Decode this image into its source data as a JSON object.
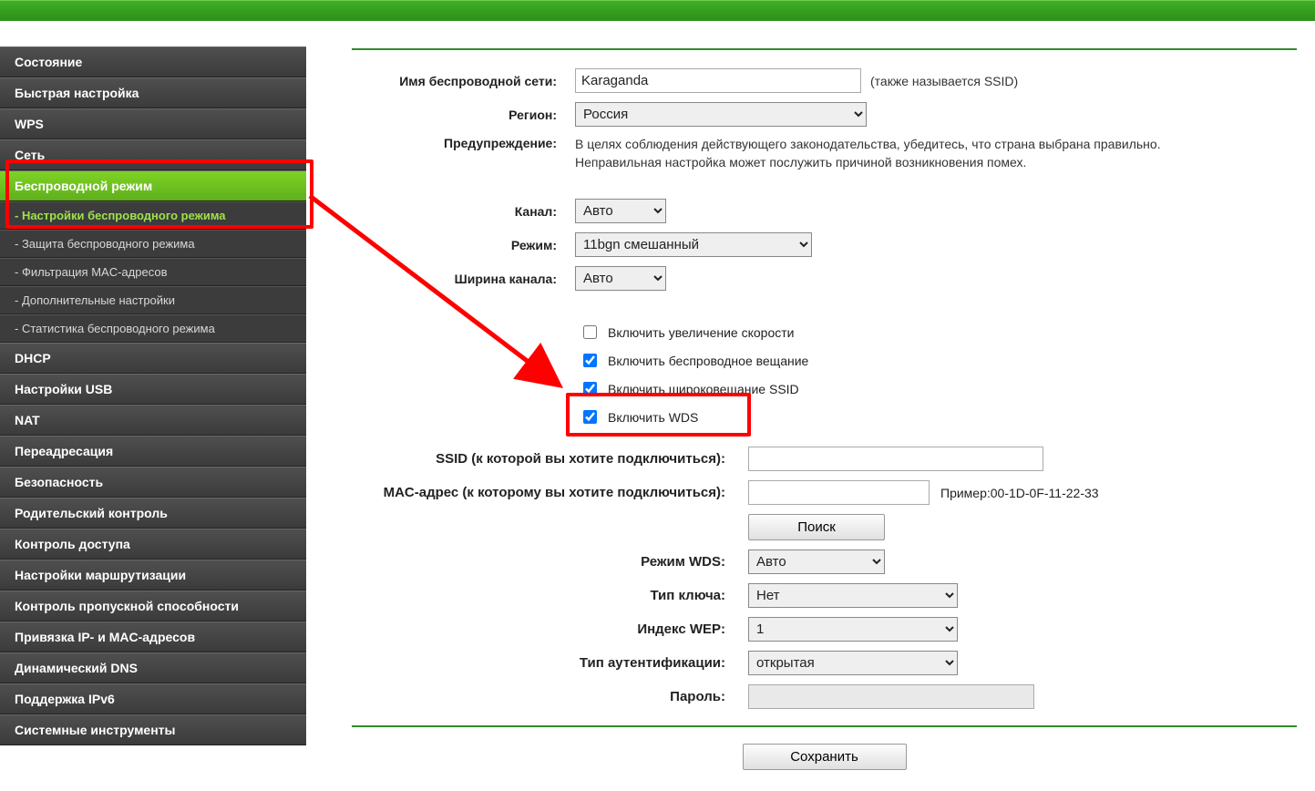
{
  "sidebar": {
    "items": [
      {
        "label": "Состояние",
        "type": "main"
      },
      {
        "label": "Быстрая настройка",
        "type": "main"
      },
      {
        "label": "WPS",
        "type": "main"
      },
      {
        "label": "Сеть",
        "type": "main"
      },
      {
        "label": "Беспроводной режим",
        "type": "main",
        "active": true
      },
      {
        "label": "- Настройки беспроводного режима",
        "type": "sub",
        "subactive": true
      },
      {
        "label": "- Защита беспроводного режима",
        "type": "sub"
      },
      {
        "label": "- Фильтрация MAC-адресов",
        "type": "sub"
      },
      {
        "label": "- Дополнительные настройки",
        "type": "sub"
      },
      {
        "label": "- Статистика беспроводного режима",
        "type": "sub"
      },
      {
        "label": "DHCP",
        "type": "main"
      },
      {
        "label": "Настройки USB",
        "type": "main"
      },
      {
        "label": "NAT",
        "type": "main"
      },
      {
        "label": "Переадресация",
        "type": "main"
      },
      {
        "label": "Безопасность",
        "type": "main"
      },
      {
        "label": "Родительский контроль",
        "type": "main"
      },
      {
        "label": "Контроль доступа",
        "type": "main"
      },
      {
        "label": "Настройки маршрутизации",
        "type": "main"
      },
      {
        "label": "Контроль пропускной способности",
        "type": "main"
      },
      {
        "label": "Привязка IP- и MAC-адресов",
        "type": "main"
      },
      {
        "label": "Динамический DNS",
        "type": "main"
      },
      {
        "label": "Поддержка IPv6",
        "type": "main"
      },
      {
        "label": "Системные инструменты",
        "type": "main"
      }
    ]
  },
  "form": {
    "ssid_label": "Имя беспроводной сети:",
    "ssid_value": "Karaganda",
    "ssid_note": "(также называется SSID)",
    "region_label": "Регион:",
    "region_value": "Россия",
    "warning_label": "Предупреждение:",
    "warning_text1": "В целях соблюдения действующего законодательства, убедитесь, что страна выбрана правильно.",
    "warning_text2": "Неправильная настройка может послужить причиной возникновения помех.",
    "channel_label": "Канал:",
    "channel_value": "Авто",
    "mode_label": "Режим:",
    "mode_value": "11bgn смешанный",
    "width_label": "Ширина канала:",
    "width_value": "Авто",
    "check_speed": "Включить увеличение скорости",
    "check_wireless": "Включить беспроводное вещание",
    "check_bc_ssid": "Включить широковещание SSID",
    "check_wds": "Включить WDS",
    "wds_ssid_label": "SSID (к которой вы хотите подключиться):",
    "wds_mac_label": "MAC-адрес (к которому вы хотите подключиться):",
    "wds_mac_example": "Пример:00-1D-0F-11-22-33",
    "wds_search_btn": "Поиск",
    "wds_mode_label": "Режим WDS:",
    "wds_mode_value": "Авто",
    "wds_key_label": "Тип ключа:",
    "wds_key_value": "Нет",
    "wds_wep_label": "Индекс WEP:",
    "wds_wep_value": "1",
    "wds_auth_label": "Тип аутентификации:",
    "wds_auth_value": "открытая",
    "wds_pass_label": "Пароль:",
    "save_btn": "Сохранить"
  }
}
